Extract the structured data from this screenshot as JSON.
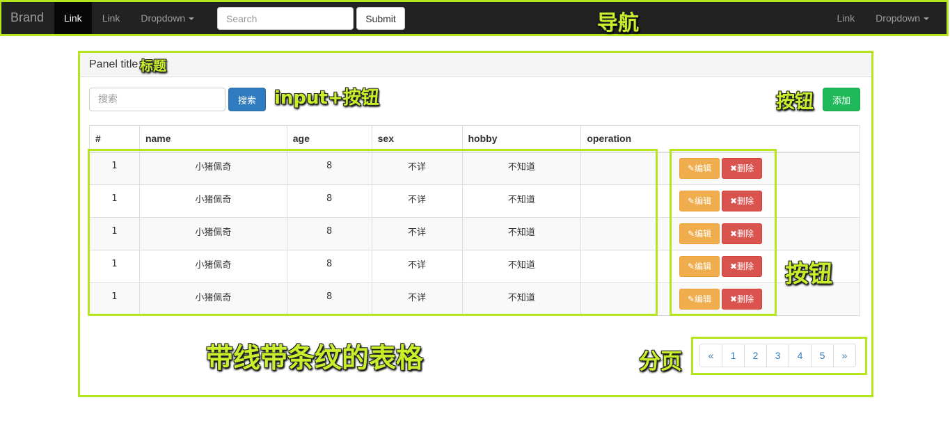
{
  "navbar": {
    "brand": "Brand",
    "left_links": [
      {
        "label": "Link",
        "active": true
      },
      {
        "label": "Link",
        "active": false
      },
      {
        "label": "Dropdown",
        "dropdown": true
      }
    ],
    "search_placeholder": "Search",
    "submit_label": "Submit",
    "right_links": [
      {
        "label": "Link"
      },
      {
        "label": "Dropdown",
        "dropdown": true
      }
    ]
  },
  "panel": {
    "title": "Panel title",
    "search_placeholder": "搜索",
    "search_button": "搜索",
    "add_button": "添加"
  },
  "table": {
    "headers": [
      "#",
      "name",
      "age",
      "sex",
      "hobby",
      "operation"
    ],
    "rows": [
      [
        "1",
        "小猪佩奇",
        "8",
        "不详",
        "不知道"
      ],
      [
        "1",
        "小猪佩奇",
        "8",
        "不详",
        "不知道"
      ],
      [
        "1",
        "小猪佩奇",
        "8",
        "不详",
        "不知道"
      ],
      [
        "1",
        "小猪佩奇",
        "8",
        "不详",
        "不知道"
      ],
      [
        "1",
        "小猪佩奇",
        "8",
        "不详",
        "不知道"
      ]
    ],
    "edit_label": "编辑",
    "delete_label": "删除",
    "edit_icon": "pencil-icon",
    "delete_icon": "close-icon"
  },
  "pagination": [
    "«",
    "1",
    "2",
    "3",
    "4",
    "5",
    "»"
  ],
  "annotations": {
    "nav": "导航",
    "title": "标题",
    "input_button": "input+按钮",
    "button_top": "按钮",
    "button_side": "按钮",
    "table": "带线带条纹的表格",
    "pagination": "分页"
  },
  "colors": {
    "highlight": "#b5e61d",
    "navbar_bg": "#222222",
    "primary": "#337ab7",
    "success": "#1fb95a",
    "warning": "#f0ad4e",
    "danger": "#d9534f"
  }
}
